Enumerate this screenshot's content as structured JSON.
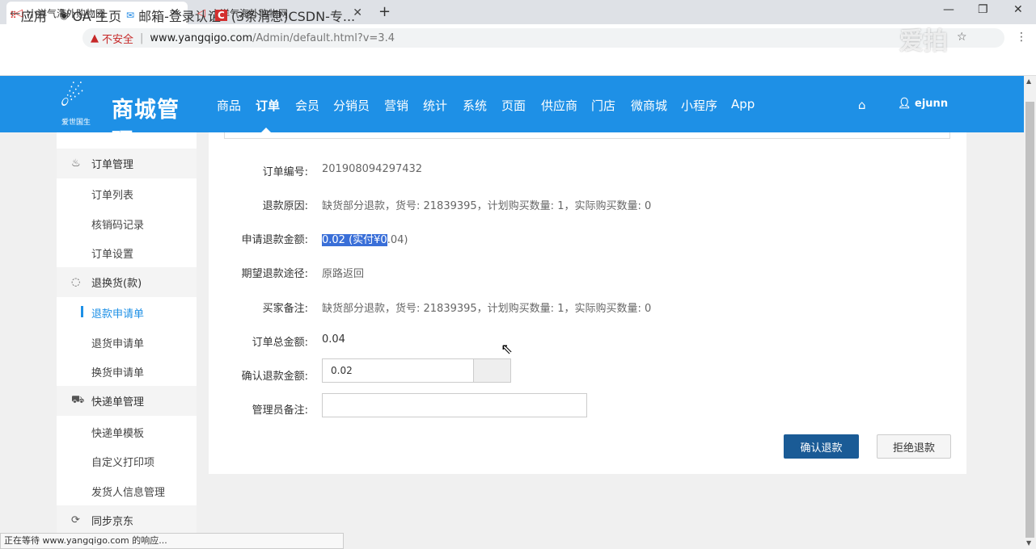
{
  "browser": {
    "tabs": [
      {
        "title": "小洋气海外购物网",
        "favicon": "send-icon"
      },
      {
        "title": "小洋气海外购物网",
        "favicon": "send-icon"
      }
    ],
    "new_tab": "+",
    "security_text": "不安全",
    "url_host": "www.yangqigo.com",
    "url_path": "/Admin/default.html?v=3.4",
    "bookmarks": [
      {
        "label": "应用",
        "icon": "apps-grid-icon"
      },
      {
        "label": "OA-主页",
        "icon": "globe-icon"
      },
      {
        "label": "邮箱-登录认证",
        "icon": "mail-icon"
      },
      {
        "label": "(3条消息)CSDN-专...",
        "icon": "csdn-icon"
      }
    ],
    "watermark": "爱拍",
    "status_text": "正在等待 www.yangqigo.com 的响应..."
  },
  "header": {
    "logo_text": "商城管理",
    "logo_sub": "爱世国生",
    "nav": [
      "商品",
      "订单",
      "会员",
      "分销员",
      "营销",
      "统计",
      "系统",
      "页面",
      "供应商",
      "门店",
      "微商城",
      "小程序",
      "App"
    ],
    "active_nav": "订单",
    "user": "ejunn",
    "brand_color": "#1e90e6"
  },
  "sidebar": {
    "groups": [
      {
        "label": "订单管理",
        "icon": "basket-icon",
        "items": [
          "订单列表",
          "核销码记录",
          "订单设置"
        ]
      },
      {
        "label": "退换货(款)",
        "icon": "refresh-icon",
        "items": [
          "退款申请单",
          "退货申请单",
          "换货申请单"
        ]
      },
      {
        "label": "快递单管理",
        "icon": "truck-icon",
        "items": [
          "快递单模板",
          "自定义打印项",
          "发货人信息管理"
        ]
      },
      {
        "label": "同步京东",
        "icon": "sync-icon",
        "items": []
      }
    ],
    "active_item": "退款申请单"
  },
  "form": {
    "order_no_label": "订单编号:",
    "order_no": "201908094297432",
    "reason_label": "退款原因:",
    "reason": "缺货部分退款，货号: 21839395，计划购买数量: 1，实际购买数量: 0",
    "apply_amount_label": "申请退款金额:",
    "apply_amount_selected": "0.02 (实付¥0",
    "apply_amount_rest": ".04)",
    "route_label": "期望退款途径:",
    "route": "原路返回",
    "buyer_note_label": "买家备注:",
    "buyer_note": "缺货部分退款，货号: 21839395，计划购买数量: 1，实际购买数量: 0",
    "total_label": "订单总金额:",
    "total": "0.04",
    "confirm_amount_label": "确认退款金额:",
    "confirm_amount": "0.02",
    "admin_note_label": "管理员备注:",
    "admin_note": "",
    "confirm_button": "确认退款",
    "reject_button": "拒绝退款",
    "confirm_color": "#1a5b96"
  }
}
